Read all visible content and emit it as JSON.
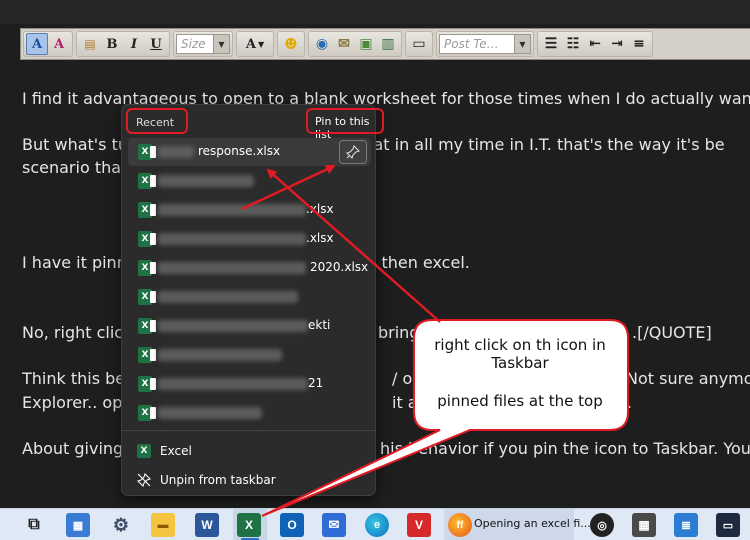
{
  "toolbar": {
    "size_placeholder": "Size",
    "post_template_placeholder": "Post Te…"
  },
  "content": {
    "line1": "I find it advantageous to open to a blank worksheet for those times when I do actually want to",
    "line2": "But what's tu",
    "line2b": "w is that in all my time in I.T. that's the way it's be",
    "line3": "scenario that",
    "line4": "I have it pinn",
    "line4b": "t, then excel.",
    "line5": "No, right click",
    "line5b": "brings",
    "line5c": ".[/QUOTE]",
    "line6": "Think this be",
    "line6b": "/ or s",
    "line6c": "Not sure anymo",
    "line7": "Explorer.. op",
    "line7b": "it and",
    "line7c": "e.",
    "line8": "About giving",
    "line8b": "his behavior if you pin the icon to Taskbar. You ca"
  },
  "jumplist": {
    "recent_header": "Recent",
    "pin_label": "Pin to this list",
    "items": [
      {
        "visible_text": "response.xlsx"
      },
      {
        "visible_text": ""
      },
      {
        "visible_text": ".xlsx"
      },
      {
        "visible_text": ".xlsx"
      },
      {
        "visible_text": "2020.xlsx"
      },
      {
        "visible_text": ""
      },
      {
        "visible_text": "ekti"
      },
      {
        "visible_text": ""
      },
      {
        "visible_text": "21"
      },
      {
        "visible_text": ""
      }
    ],
    "app_action": "Excel",
    "unpin_action": "Unpin from taskbar"
  },
  "callout": {
    "line1": "right click on th icon in",
    "line2": "Taskbar",
    "line3": "pinned files at the top"
  },
  "taskbar": {
    "firefox_task_label": "Opening an excel fi..."
  },
  "colors": {
    "annotation_red": "#e01b24",
    "excel_green": "#1f7244",
    "jumplist_bg": "#2b2b2b",
    "taskbar_bg": "#dfe9f5"
  }
}
